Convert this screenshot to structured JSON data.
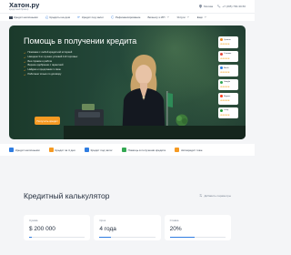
{
  "header": {
    "logo_main": "Хатон.ру",
    "logo_tag": "кредитный брокер",
    "region": "Москва",
    "phone": "+7 (495) 790-30-50"
  },
  "nav": {
    "items": [
      {
        "label": "Кредит наличными",
        "icon": "wallet-icon"
      },
      {
        "label": "Кредиты на дом",
        "icon": "home-icon"
      },
      {
        "label": "Кредит под залог",
        "icon": "key-icon"
      },
      {
        "label": "Рефинансирование",
        "icon": "refresh-icon"
      },
      {
        "label": "Бизнесу и ИП",
        "icon": "briefcase-icon"
      },
      {
        "label": "Услуги",
        "icon": "services-icon"
      },
      {
        "label": "Ещё",
        "icon": "more-icon"
      }
    ]
  },
  "hero": {
    "title": "Помощь в получении кредита",
    "bullets": [
      "Поможем с любой кредитной историей",
      "Находим 3 из лучших условий 110 торговых",
      "Без справок о работе",
      "Верное одобрение с гарантией",
      "Найдем и предложим 1 свою",
      "Работаем только по договору"
    ],
    "button_label": "Получить кредит"
  },
  "ratings": [
    {
      "name": "Сравни",
      "color": "#f08a24",
      "stars": "★★★★★"
    },
    {
      "name": "Отзовик",
      "color": "#e64a3b",
      "stars": "★★★★★"
    },
    {
      "name": "Banki",
      "color": "#2d7fe0",
      "stars": "★★★★★"
    },
    {
      "name": "Google",
      "color": "#34a853",
      "stars": "★★★★★"
    },
    {
      "name": "Яндекс",
      "color": "#fc3f1d",
      "stars": "★★★★★"
    },
    {
      "name": "Сбер",
      "color": "#21a038",
      "stars": "★★★★★"
    }
  ],
  "services": [
    {
      "label": "Кредит наличными",
      "color": "#2f7de1"
    },
    {
      "label": "Кредит за 4 дня",
      "color": "#f59a23"
    },
    {
      "label": "Кредит под залог",
      "color": "#2f7de1"
    },
    {
      "label": "Помощь в получении кредита",
      "color": "#34a853"
    },
    {
      "label": "Автокредит тоже",
      "color": "#f59a23"
    }
  ],
  "calculator": {
    "title": "Кредитный калькулятор",
    "link": "Добавить параметры",
    "cards": [
      {
        "label": "Сумма",
        "value": "$ 200 000",
        "level": 0.05
      },
      {
        "label": "Срок",
        "value": "4 года",
        "level": 0.2
      },
      {
        "label": "Ставка",
        "value": "20%",
        "level": 0.45
      }
    ]
  }
}
